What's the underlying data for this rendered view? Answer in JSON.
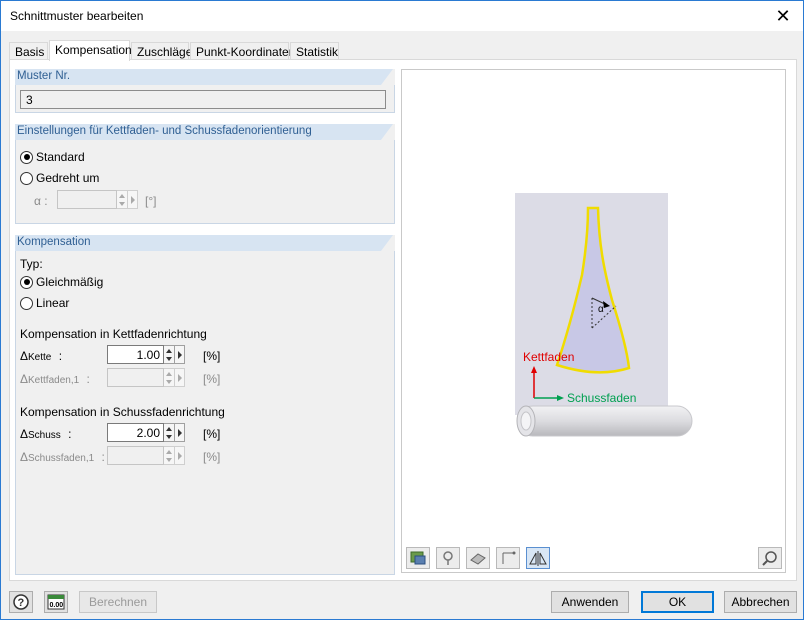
{
  "window": {
    "title": "Schnittmuster bearbeiten",
    "close_glyph": "✕"
  },
  "tabs": [
    {
      "label": "Basis"
    },
    {
      "label": "Kompensation"
    },
    {
      "label": "Zuschläge"
    },
    {
      "label": "Punkt-Koordinaten"
    },
    {
      "label": "Statistik"
    }
  ],
  "muster": {
    "header": "Muster Nr.",
    "value": "3"
  },
  "orientation": {
    "header": "Einstellungen für Kettfaden- und Schussfadenorientierung",
    "opt_standard": "Standard",
    "opt_gedreht": "Gedreht um",
    "alpha_label": "α :",
    "alpha_unit": "[°]"
  },
  "kompensation": {
    "header": "Kompensation",
    "typ_label": "Typ:",
    "opt_gleich": "Gleichmäßig",
    "opt_linear": "Linear",
    "kette_section": "Kompensation in Kettfadenrichtung",
    "kette_label": "Δ",
    "kette_sub": "Kette",
    "kette_colon": ":",
    "kette_value": "1.00",
    "kette_unit": "[%]",
    "kette1_label": "Δ",
    "kette1_sub": "Kettfaden,1",
    "kette1_colon": ":",
    "kette1_unit": "[%]",
    "schuss_section": "Kompensation in Schussfadenrichtung",
    "schuss_label": "Δ",
    "schuss_sub": "Schuss",
    "schuss_colon": ":",
    "schuss_value": "2.00",
    "schuss_unit": "[%]",
    "schuss1_label": "Δ",
    "schuss1_sub": "Schussfaden,1",
    "schuss1_colon": ":",
    "schuss1_unit": "[%]"
  },
  "preview": {
    "kettfaden_label": "Kettfaden",
    "schussfaden_label": "Schussfaden",
    "alpha_glyph": "α",
    "colors": {
      "kett": "#e00000",
      "schuss": "#00a050",
      "outline": "#f0dc00",
      "fill": "#c8c8e6"
    }
  },
  "preview_toolbar": [
    "view-options-icon",
    "pin-icon",
    "fabric-icon",
    "axes-icon",
    "mirror-icon",
    "zoom-icon"
  ],
  "footer": {
    "help_icon": "help-icon",
    "units_icon": "units-icon",
    "units_text": "0.00",
    "berechnen": "Berechnen",
    "anwenden": "Anwenden",
    "ok": "OK",
    "abbrechen": "Abbrechen"
  }
}
